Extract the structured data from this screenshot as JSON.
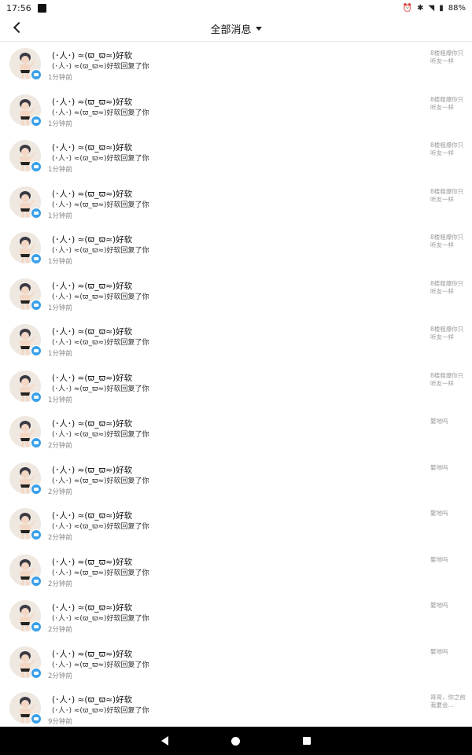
{
  "status": {
    "time": "17:56",
    "battery": "88%",
    "alarm_icon": "alarm-icon",
    "bluetooth_icon": "bluetooth-icon",
    "wifi_icon": "wifi-icon",
    "battery_icon": "battery-icon"
  },
  "header": {
    "title": "全部消息",
    "back_icon": "chevron-left-icon",
    "dropdown_icon": "caret-down-icon"
  },
  "colors": {
    "badge": "#3aa0e8",
    "avatar_bg": "#efe8e1"
  },
  "items": [
    {
      "name": "(･人･) ≈(ϖ_ϖ≈)好软",
      "message": "(･人･) ≈(ϖ_ϖ≈)好软回复了你",
      "time": "1分钟前",
      "preview": "8楼粗爆你只听友一样"
    },
    {
      "name": "(･人･) ≈(ϖ_ϖ≈)好软",
      "message": "(･人･) ≈(ϖ_ϖ≈)好软回复了你",
      "time": "1分钟前",
      "preview": "8楼粗爆你只听友一样"
    },
    {
      "name": "(･人･) ≈(ϖ_ϖ≈)好软",
      "message": "(･人･) ≈(ϖ_ϖ≈)好软回复了你",
      "time": "1分钟前",
      "preview": "8楼粗爆你只听友一样"
    },
    {
      "name": "(･人･) ≈(ϖ_ϖ≈)好软",
      "message": "(･人･) ≈(ϖ_ϖ≈)好软回复了你",
      "time": "1分钟前",
      "preview": "8楼粗爆你只听友一样"
    },
    {
      "name": "(･人･) ≈(ϖ_ϖ≈)好软",
      "message": "(･人･) ≈(ϖ_ϖ≈)好软回复了你",
      "time": "1分钟前",
      "preview": "8楼粗爆你只听友一样"
    },
    {
      "name": "(･人･) ≈(ϖ_ϖ≈)好软",
      "message": "(･人･) ≈(ϖ_ϖ≈)好软回复了你",
      "time": "1分钟前",
      "preview": "8楼粗爆你只听友一样"
    },
    {
      "name": "(･人･) ≈(ϖ_ϖ≈)好软",
      "message": "(･人･) ≈(ϖ_ϖ≈)好软回复了你",
      "time": "1分钟前",
      "preview": "8楼粗爆你只听友一样"
    },
    {
      "name": "(･人･) ≈(ϖ_ϖ≈)好软",
      "message": "(･人･) ≈(ϖ_ϖ≈)好软回复了你",
      "time": "1分钟前",
      "preview": "8楼粗爆你只听友一样"
    },
    {
      "name": "(･人･) ≈(ϖ_ϖ≈)好软",
      "message": "(･人･) ≈(ϖ_ϖ≈)好软回复了你",
      "time": "2分钟前",
      "preview": "娶地吗"
    },
    {
      "name": "(･人･) ≈(ϖ_ϖ≈)好软",
      "message": "(･人･) ≈(ϖ_ϖ≈)好软回复了你",
      "time": "2分钟前",
      "preview": "娶地吗"
    },
    {
      "name": "(･人･) ≈(ϖ_ϖ≈)好软",
      "message": "(･人･) ≈(ϖ_ϖ≈)好软回复了你",
      "time": "2分钟前",
      "preview": "娶地吗"
    },
    {
      "name": "(･人･) ≈(ϖ_ϖ≈)好软",
      "message": "(･人･) ≈(ϖ_ϖ≈)好软回复了你",
      "time": "2分钟前",
      "preview": "娶地吗"
    },
    {
      "name": "(･人･) ≈(ϖ_ϖ≈)好软",
      "message": "(･人･) ≈(ϖ_ϖ≈)好软回复了你",
      "time": "2分钟前",
      "preview": "娶地吗"
    },
    {
      "name": "(･人･) ≈(ϖ_ϖ≈)好软",
      "message": "(･人･) ≈(ϖ_ϖ≈)好软回复了你",
      "time": "2分钟前",
      "preview": "娶地吗"
    },
    {
      "name": "(･人･) ≈(ϖ_ϖ≈)好软",
      "message": "(･人･) ≈(ϖ_ϖ≈)好软回复了你",
      "time": "9分钟前",
      "preview": "哥哥，你之前我要会…"
    }
  ],
  "navbar": {
    "back_icon": "triangle-back-icon",
    "home_icon": "circle-home-icon",
    "recents_icon": "square-recents-icon"
  }
}
